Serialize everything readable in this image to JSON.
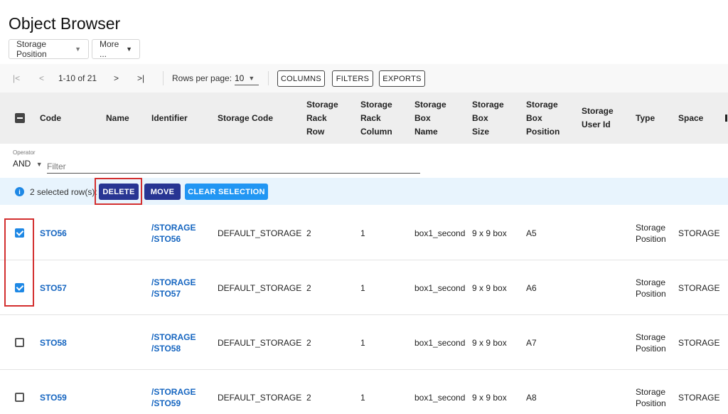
{
  "page": {
    "title": "Object Browser"
  },
  "top_buttons": {
    "storage_position": "Storage Position",
    "more": "More ..."
  },
  "toolbar": {
    "range": "1-10 of 21",
    "rows_per_page_label": "Rows per page:",
    "rows_per_page_value": "10",
    "columns": "COLUMNS",
    "filters": "FILTERS",
    "exports": "EXPORTS",
    "first_glyph": "|<",
    "prev_glyph": "<",
    "next_glyph": ">",
    "last_glyph": ">|"
  },
  "columns": [
    {
      "label": "Code"
    },
    {
      "label": "Name"
    },
    {
      "label": "Identifier"
    },
    {
      "label": "Storage Code"
    },
    {
      "label": "Storage\nRack\nRow"
    },
    {
      "label": "Storage\nRack\nColumn"
    },
    {
      "label": "Storage\nBox\nName"
    },
    {
      "label": "Storage\nBox\nSize"
    },
    {
      "label": "Storage\nBox\nPosition"
    },
    {
      "label": "Storage\nUser Id"
    },
    {
      "label": "Type"
    },
    {
      "label": "Space"
    }
  ],
  "filter": {
    "operator_label": "Operator",
    "operator_value": "AND",
    "placeholder": "Filter"
  },
  "selection": {
    "info_glyph": "i",
    "text": "2 selected row(s):",
    "delete": "DELETE",
    "move": "MOVE",
    "clear": "CLEAR SELECTION"
  },
  "rows": [
    {
      "checked": true,
      "code": "STO56",
      "name": "",
      "identifier": "/STORAGE\n/STO56",
      "storage_code": "DEFAULT_STORAGE",
      "rack_row": "2",
      "rack_column": "1",
      "box_name": "box1_second",
      "box_size": "9 x 9 box",
      "box_position": "A5",
      "user_id": "",
      "type": "Storage\nPosition",
      "space": "STORAGE"
    },
    {
      "checked": true,
      "code": "STO57",
      "name": "",
      "identifier": "/STORAGE\n/STO57",
      "storage_code": "DEFAULT_STORAGE",
      "rack_row": "2",
      "rack_column": "1",
      "box_name": "box1_second",
      "box_size": "9 x 9 box",
      "box_position": "A6",
      "user_id": "",
      "type": "Storage\nPosition",
      "space": "STORAGE"
    },
    {
      "checked": false,
      "code": "STO58",
      "name": "",
      "identifier": "/STORAGE\n/STO58",
      "storage_code": "DEFAULT_STORAGE",
      "rack_row": "2",
      "rack_column": "1",
      "box_name": "box1_second",
      "box_size": "9 x 9 box",
      "box_position": "A7",
      "user_id": "",
      "type": "Storage\nPosition",
      "space": "STORAGE"
    },
    {
      "checked": false,
      "code": "STO59",
      "name": "",
      "identifier": "/STORAGE\n/STO59",
      "storage_code": "DEFAULT_STORAGE",
      "rack_row": "2",
      "rack_column": "1",
      "box_name": "box1_second",
      "box_size": "9 x 9 box",
      "box_position": "A8",
      "user_id": "",
      "type": "Storage\nPosition",
      "space": "STORAGE"
    }
  ],
  "colors": {
    "accent": "#1e88e5",
    "action_button": "#283593",
    "clear_button": "#2196f3",
    "highlight": "#d32f2f",
    "link": "#1565c0"
  }
}
